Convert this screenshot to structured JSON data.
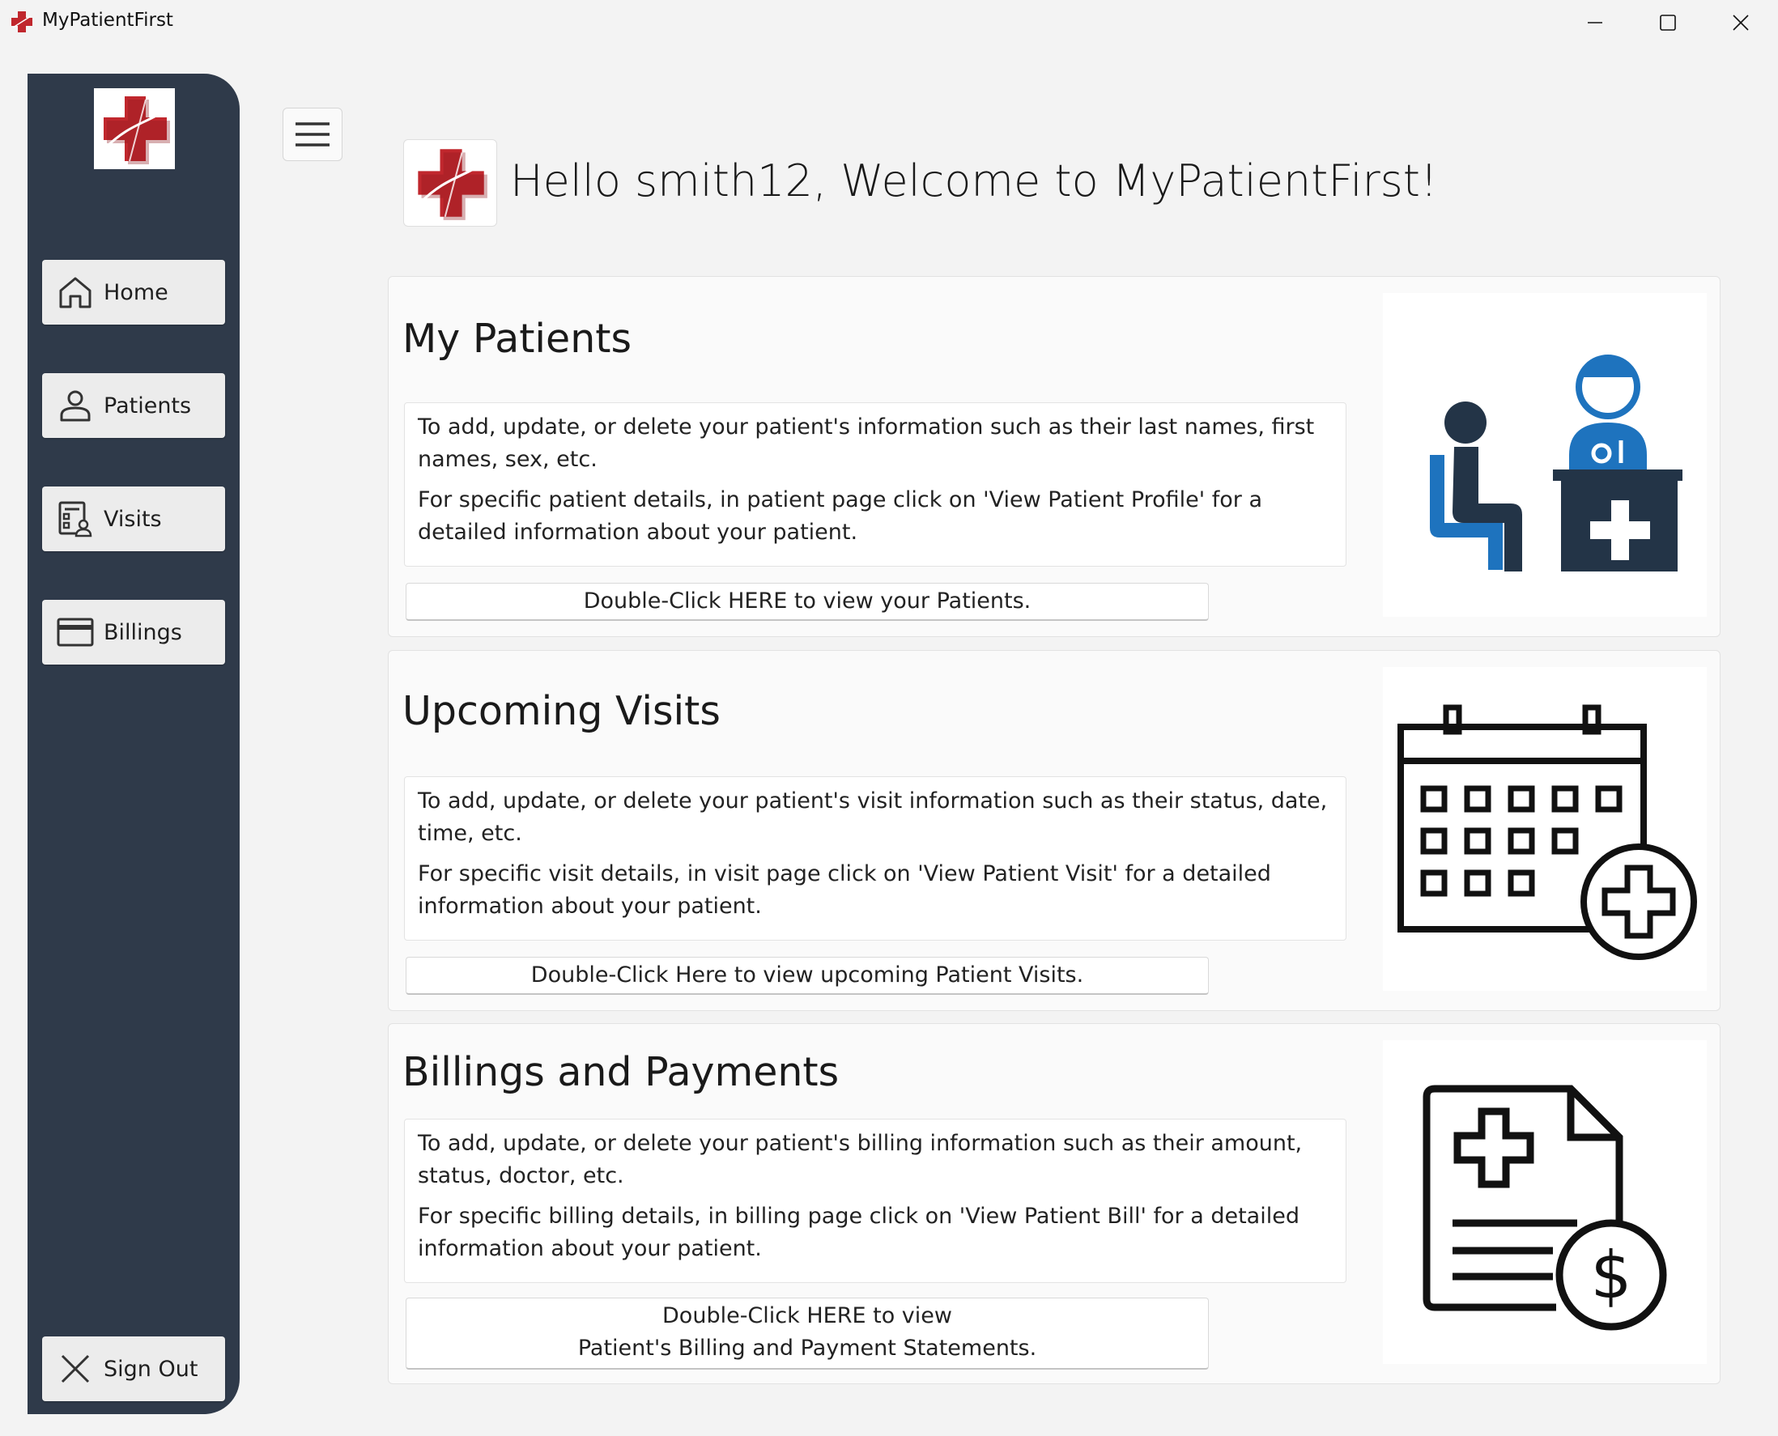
{
  "window": {
    "title": "MyPatientFirst",
    "icons": {
      "app": "medical-cross-icon",
      "minimize": "minimize-icon",
      "maximize": "maximize-icon",
      "close": "close-icon"
    }
  },
  "sidebar": {
    "logo": "medical-cross-logo",
    "items": [
      {
        "label": "Home",
        "icon": "home-icon"
      },
      {
        "label": "Patients",
        "icon": "person-icon"
      },
      {
        "label": "Visits",
        "icon": "visits-icon"
      },
      {
        "label": "Billings",
        "icon": "credit-card-icon"
      }
    ],
    "signout": {
      "label": "Sign Out",
      "icon": "x-icon"
    }
  },
  "header": {
    "greeting": "Hello smith12, Welcome to MyPatientFirst!"
  },
  "cards": [
    {
      "title": "My Patients",
      "desc1": "To add, update, or delete your patient's information such as their last names, first names, sex, etc.",
      "desc2": "For specific patient details, in patient page click on 'View Patient Profile' for a detailed information about your patient.",
      "button_line1": "Double-Click HERE to view your Patients.",
      "image": "doctor-patient-illustration"
    },
    {
      "title": "Upcoming Visits",
      "desc1": "To add, update, or delete your patient's visit information such as their status, date, time, etc.",
      "desc2": "For specific visit details, in visit page click on 'View Patient Visit' for a detailed information about your patient.",
      "button_line1": "Double-Click Here to view upcoming Patient Visits.",
      "image": "calendar-plus-illustration"
    },
    {
      "title": "Billings and Payments",
      "desc1": "To add, update, or delete your patient's billing information such as their amount, status, doctor, etc.",
      "desc2": "For specific billing details, in billing page click on 'View Patient Bill' for a detailed information about your patient.",
      "button_line1": "Double-Click HERE to view",
      "button_line2": "Patient's Billing and Payment Statements.",
      "image": "medical-bill-dollar-illustration"
    }
  ],
  "colors": {
    "sidebar": "#2f3a4a",
    "brand_red": "#c0272d",
    "icon_blue": "#1e73be",
    "icon_navy": "#233447"
  }
}
